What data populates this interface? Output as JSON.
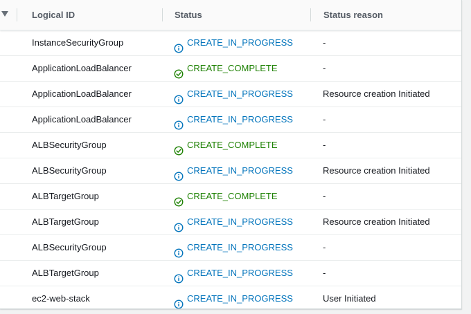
{
  "header": {
    "logical_id": "Logical ID",
    "status": "Status",
    "status_reason": "Status reason"
  },
  "colors": {
    "in_progress": "#0073bb",
    "complete": "#1d8102"
  },
  "rows": [
    {
      "logical_id": "InstanceSecurityGroup",
      "status": "CREATE_IN_PROGRESS",
      "status_icon": "info-icon",
      "reason": "-"
    },
    {
      "logical_id": "ApplicationLoadBalancer",
      "status": "CREATE_COMPLETE",
      "status_icon": "success-check-icon",
      "reason": "-"
    },
    {
      "logical_id": "ApplicationLoadBalancer",
      "status": "CREATE_IN_PROGRESS",
      "status_icon": "info-icon",
      "reason": "Resource creation Initiated"
    },
    {
      "logical_id": "ApplicationLoadBalancer",
      "status": "CREATE_IN_PROGRESS",
      "status_icon": "info-icon",
      "reason": "-"
    },
    {
      "logical_id": "ALBSecurityGroup",
      "status": "CREATE_COMPLETE",
      "status_icon": "success-check-icon",
      "reason": "-"
    },
    {
      "logical_id": "ALBSecurityGroup",
      "status": "CREATE_IN_PROGRESS",
      "status_icon": "info-icon",
      "reason": "Resource creation Initiated"
    },
    {
      "logical_id": "ALBTargetGroup",
      "status": "CREATE_COMPLETE",
      "status_icon": "success-check-icon",
      "reason": "-"
    },
    {
      "logical_id": "ALBTargetGroup",
      "status": "CREATE_IN_PROGRESS",
      "status_icon": "info-icon",
      "reason": "Resource creation Initiated"
    },
    {
      "logical_id": "ALBSecurityGroup",
      "status": "CREATE_IN_PROGRESS",
      "status_icon": "info-icon",
      "reason": "-"
    },
    {
      "logical_id": "ALBTargetGroup",
      "status": "CREATE_IN_PROGRESS",
      "status_icon": "info-icon",
      "reason": "-"
    },
    {
      "logical_id": "ec2-web-stack",
      "status": "CREATE_IN_PROGRESS",
      "status_icon": "info-icon",
      "reason": "User Initiated"
    }
  ]
}
